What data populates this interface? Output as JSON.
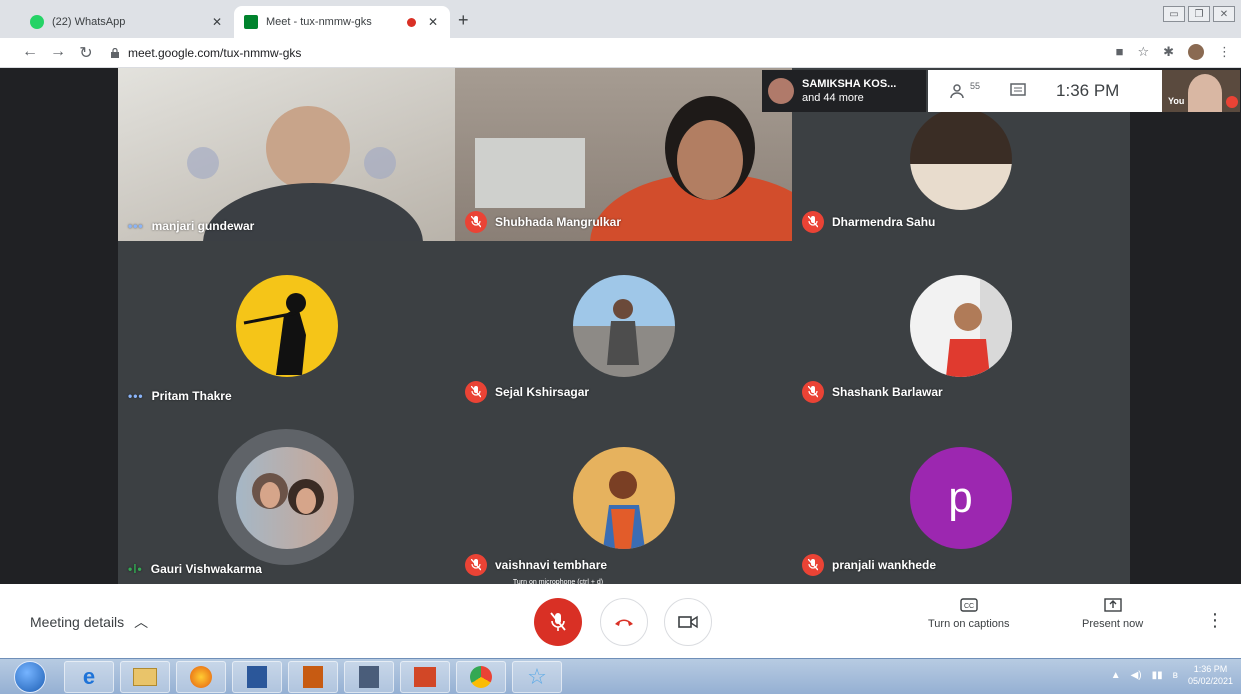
{
  "browser": {
    "tabs": [
      {
        "title": "(22) WhatsApp",
        "active": false,
        "favicon_color": "#25d366"
      },
      {
        "title": "Meet - tux-nmmw-gks",
        "active": true,
        "favicon_color": "#00832d"
      }
    ],
    "new_tab": "+",
    "url": "meet.google.com/tux-nmmw-gks"
  },
  "meet": {
    "pinned_label": "SAMIKSHA KOS...",
    "pinned_more": "and 44 more",
    "participant_count": "55",
    "time": "1:36 PM",
    "self_label": "You",
    "tooltip": "Turn on microphone (ctrl + d)",
    "meeting_details": "Meeting details",
    "captions_label": "Turn on captions",
    "present_label": "Present now",
    "participants": [
      {
        "name": "manjari gundewar",
        "status": "speaking",
        "kind": "video",
        "colors": [
          "#d7d6d2",
          "#a9a39a"
        ]
      },
      {
        "name": "Shubhada Mangrulkar",
        "status": "muted",
        "kind": "video",
        "colors": [
          "#8d7f74",
          "#d24d2c"
        ]
      },
      {
        "name": "Dharmendra Sahu",
        "status": "muted",
        "kind": "avatar",
        "colors": [
          "#3a2d25",
          "#e8dccd"
        ]
      },
      {
        "name": "Pritam Thakre",
        "status": "speaking",
        "kind": "avatar",
        "colors": [
          "#f5c518",
          "#111111"
        ]
      },
      {
        "name": "Sejal Kshirsagar",
        "status": "muted",
        "kind": "avatar",
        "colors": [
          "#9fc7e8",
          "#4d4d4d"
        ]
      },
      {
        "name": "Shashank Barlawar",
        "status": "muted",
        "kind": "avatar",
        "colors": [
          "#f2f2f2",
          "#e03a2f"
        ]
      },
      {
        "name": "Gauri Vishwakarma",
        "status": "speaking",
        "kind": "avatar",
        "colors": [
          "#a5b7c6",
          "#6b5348"
        ]
      },
      {
        "name": "vaishnavi tembhare",
        "status": "muted",
        "kind": "avatar",
        "colors": [
          "#e6b25e",
          "#7a3f24"
        ]
      },
      {
        "name": "pranjali wankhede",
        "status": "muted",
        "kind": "letter",
        "letter": "p",
        "colors": [
          "#9c27b0",
          "#ffffff"
        ]
      }
    ]
  },
  "taskbar": {
    "time": "1:36 PM",
    "date": "05/02/2021"
  }
}
